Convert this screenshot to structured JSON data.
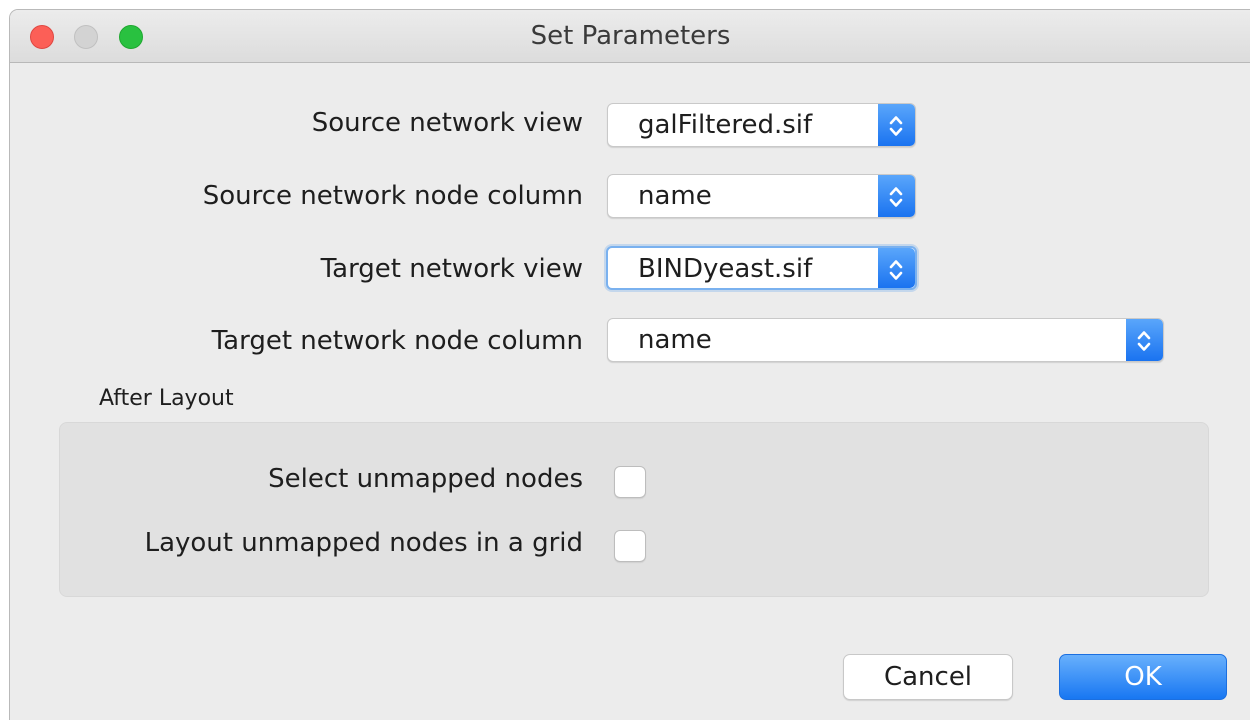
{
  "window": {
    "title": "Set Parameters"
  },
  "fields": [
    {
      "label": "Source network view",
      "value": "galFiltered.sif"
    },
    {
      "label": "Source network node column",
      "value": "name"
    },
    {
      "label": "Target network view",
      "value": "BINDyeast.sif"
    },
    {
      "label": "Target network node column",
      "value": "name"
    }
  ],
  "after_layout": {
    "label": "After Layout",
    "options": [
      {
        "label": "Select unmapped nodes",
        "checked": false
      },
      {
        "label": "Layout unmapped nodes in a grid",
        "checked": false
      }
    ]
  },
  "buttons": {
    "cancel": "Cancel",
    "ok": "OK"
  },
  "colors": {
    "accent": "#1a73f0",
    "close": "#fc5f57",
    "maximize": "#29c140"
  }
}
